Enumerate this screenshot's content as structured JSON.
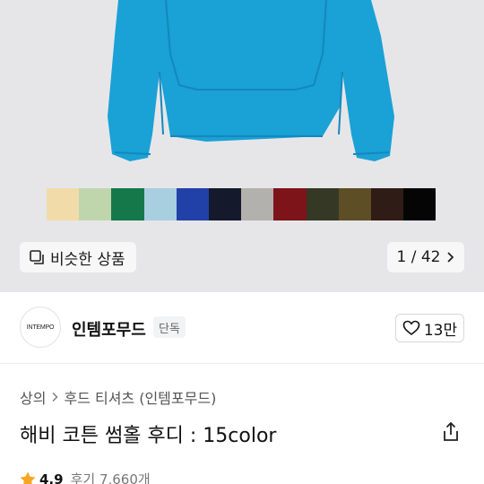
{
  "product": {
    "swatches": [
      "#f1dca9",
      "#bfd6ad",
      "#15784a",
      "#a8cfe0",
      "#2141a8",
      "#141a2c",
      "#b3b1ad",
      "#7c1419",
      "#353824",
      "#5e4e26",
      "#2f1c17",
      "#050505"
    ],
    "hoodie_color": "#1aa1d6",
    "similar_label": "비슷한 상품",
    "pager_text": "1 / 42",
    "brand": {
      "logo_text": "INTEMPO",
      "name": "인템포무드",
      "badge": "단독",
      "likes": "13만"
    },
    "breadcrumb": {
      "category": "상의",
      "sub": "후드 티셔츠 (인템포무드)"
    },
    "title": "해비 코튼 썸홀 후디 : 15color",
    "rating": {
      "score": "4.9",
      "reviews": "후기 7,660개",
      "star_color": "#f5a623"
    }
  }
}
